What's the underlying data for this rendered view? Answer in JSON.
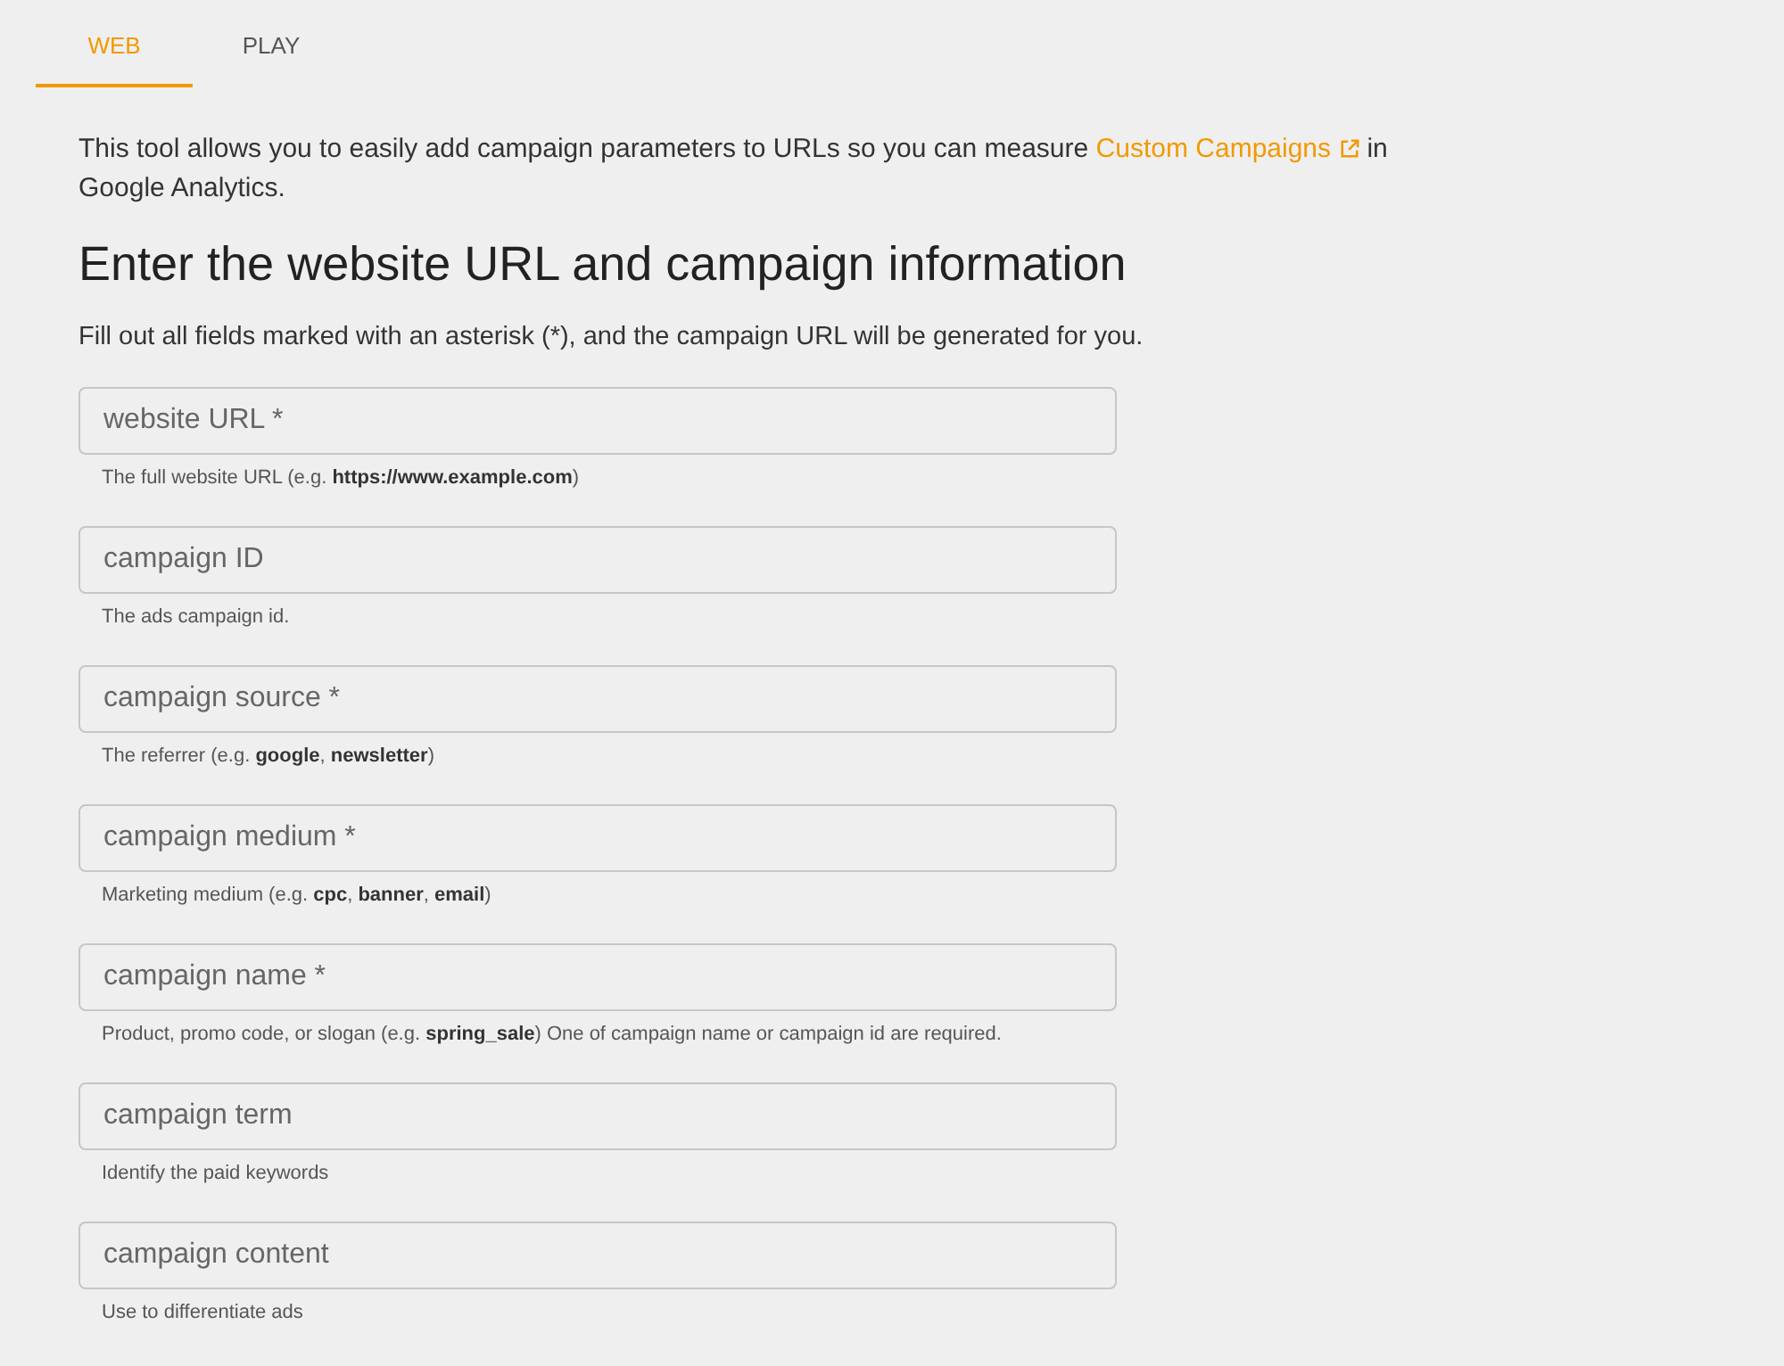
{
  "tabs": [
    {
      "label": "WEB",
      "selected": true
    },
    {
      "label": "PLAY",
      "selected": false
    }
  ],
  "intro": {
    "text_before": "This tool allows you to easily add campaign parameters to URLs so you can measure",
    "link": "Custom Campaigns",
    "text_after": "in Google Analytics."
  },
  "heading": "Enter the website URL and campaign information",
  "instructions": "Fill out all fields marked with an asterisk (*), and the campaign URL will be generated for you.",
  "fields": [
    {
      "placeholder": "website URL *",
      "helper": "The full website URL (e.g. **https://www.example.com**)"
    },
    {
      "placeholder": "campaign ID",
      "helper": "The ads campaign id."
    },
    {
      "placeholder": "campaign source *",
      "helper": "The referrer (e.g. **google**, **newsletter**)"
    },
    {
      "placeholder": "campaign medium *",
      "helper": "Marketing medium (e.g. **cpc**, **banner**, **email**)"
    },
    {
      "placeholder": "campaign name *",
      "helper": "Product, promo code, or slogan (e.g. **spring_sale**) One of campaign name or campaign id are required."
    },
    {
      "placeholder": "campaign term",
      "helper": "Identify the paid keywords"
    },
    {
      "placeholder": "campaign content",
      "helper": "Use to differentiate ads"
    }
  ]
}
